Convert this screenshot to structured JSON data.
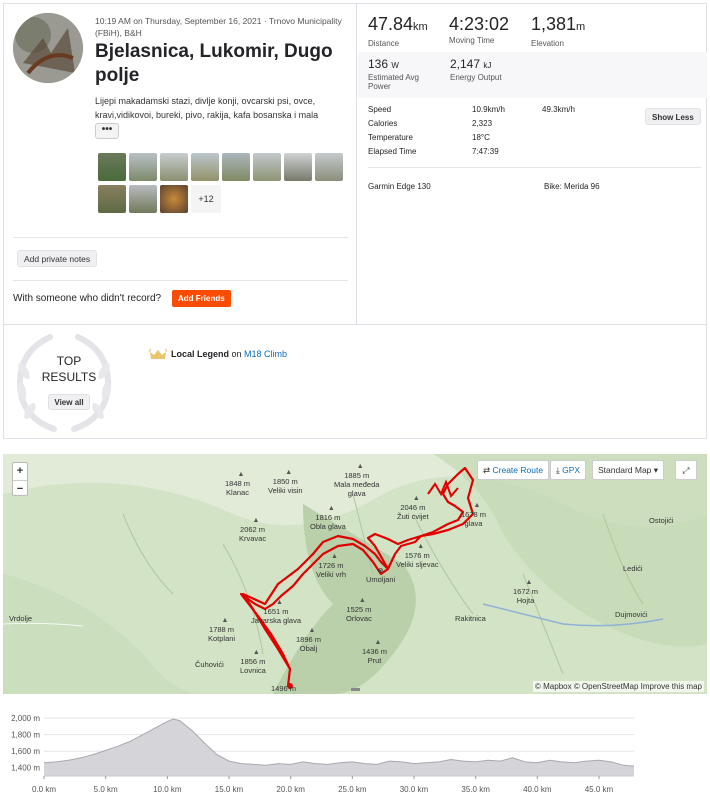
{
  "activity": {
    "meta_line": "10:19 AM on Thursday, September 16, 2021 · Trnovo Municipality (FBiH), B&H",
    "title": "Bjelasnica, Lukomir, Dugo polje",
    "description": "Lijepi makadamski stazi, divlje konji, ovcarski psi, ovce, kravi,vidikovoi, bureki, pivo, rakija, kafa bosanska i mala",
    "more_label": "•••",
    "photos_more": "+12",
    "private_notes_label": "Add private notes",
    "record_prompt": "With someone who didn't record?",
    "add_friends_label": "Add Friends"
  },
  "stats_primary": [
    {
      "value": "47.84",
      "unit": "km",
      "label": "Distance"
    },
    {
      "value": "4:23:02",
      "unit": "",
      "label": "Moving Time"
    },
    {
      "value": "1,381",
      "unit": "m",
      "label": "Elevation"
    }
  ],
  "stats_secondary": [
    {
      "value": "136",
      "unit": "W",
      "label": "Estimated Avg Power"
    },
    {
      "value": "2,147",
      "unit": "kJ",
      "label": "Energy Output"
    }
  ],
  "details": [
    {
      "label": "Speed",
      "value": "10.9km/h",
      "max": "49.3km/h"
    },
    {
      "label": "Calories",
      "value": "2,323",
      "max": ""
    },
    {
      "label": "Temperature",
      "value": "18°C",
      "max": ""
    },
    {
      "label": "Elapsed Time",
      "value": "7:47:39",
      "max": ""
    }
  ],
  "show_less_label": "Show Less",
  "device": "Garmin Edge 130",
  "bike": "Bike: Merida 96",
  "top_results": {
    "heading": "TOP RESULTS",
    "view_all_label": "View all",
    "legend_prefix": "Local Legend",
    "legend_mid": " on ",
    "legend_segment": "M18 Climb"
  },
  "map": {
    "zoom_in": "+",
    "zoom_out": "−",
    "create_route": "Create Route",
    "gpx": "GPX",
    "map_style": "Standard Map",
    "attribution": "© Mapbox © OpenStreetMap Improve this map",
    "peaks": [
      {
        "name": "1885 m\nMala međeda\nglava"
      },
      {
        "name": "1848 m\nKlanac"
      },
      {
        "name": "1850 m\nVeliki visin"
      },
      {
        "name": "2046 m\nŽuti cvijet"
      },
      {
        "name": "1816 m\nObla glava"
      },
      {
        "name": "1678 m\nglava"
      },
      {
        "name": "2062 m\nKrvavac"
      },
      {
        "name": "1726 m\nVeliki vrh"
      },
      {
        "name": "1576 m\nVeliki sljevac"
      },
      {
        "name": "1672 m\nHojta"
      },
      {
        "name": "1651 m\nJavarska glava"
      },
      {
        "name": "1525 m\nOrlovac"
      },
      {
        "name": "1788 m\nKotplani"
      },
      {
        "name": "1896 m\nObalj"
      },
      {
        "name": "1436 m\nPrut"
      },
      {
        "name": "1856 m\nLovnica"
      },
      {
        "name": "1496 m"
      }
    ],
    "places": [
      "Umoljani",
      "Ostojići",
      "Ledići",
      "Rakitnica",
      "Dujmovići",
      "Vrdolje",
      "Čuhovići"
    ]
  },
  "chart_data": {
    "type": "area",
    "title": "",
    "xlabel": "",
    "ylabel": "",
    "x_ticks": [
      "0.0 km",
      "5.0 km",
      "10.0 km",
      "15.0 km",
      "20.0 km",
      "25.0 km",
      "30.0 km",
      "35.0 km",
      "40.0 km",
      "45.0 km"
    ],
    "y_ticks": [
      "2,000 m",
      "1,800 m",
      "1,600 m",
      "1,400 m"
    ],
    "xlim": [
      0,
      47.84
    ],
    "ylim": [
      1300,
      2050
    ],
    "x": [
      0,
      1,
      2,
      3,
      4,
      5,
      6,
      7,
      8,
      9,
      10,
      10.5,
      11,
      12,
      13,
      14,
      15,
      16,
      17,
      18,
      19,
      20,
      21,
      22,
      23,
      24,
      25,
      26,
      27,
      28,
      29,
      30,
      31,
      32,
      33,
      34,
      35,
      36,
      37,
      38,
      39,
      40,
      41,
      42,
      43,
      44,
      45,
      46,
      47,
      47.84
    ],
    "y": [
      1460,
      1470,
      1490,
      1520,
      1560,
      1610,
      1660,
      1720,
      1800,
      1880,
      1960,
      1990,
      1970,
      1850,
      1700,
      1560,
      1480,
      1450,
      1440,
      1430,
      1450,
      1440,
      1470,
      1450,
      1440,
      1460,
      1470,
      1450,
      1440,
      1480,
      1470,
      1450,
      1460,
      1470,
      1500,
      1480,
      1470,
      1490,
      1480,
      1520,
      1470,
      1460,
      1490,
      1470,
      1460,
      1480,
      1490,
      1470,
      1430,
      1420
    ],
    "fill_color": "#d4d4d9",
    "line_color": "#a8a8b0"
  }
}
